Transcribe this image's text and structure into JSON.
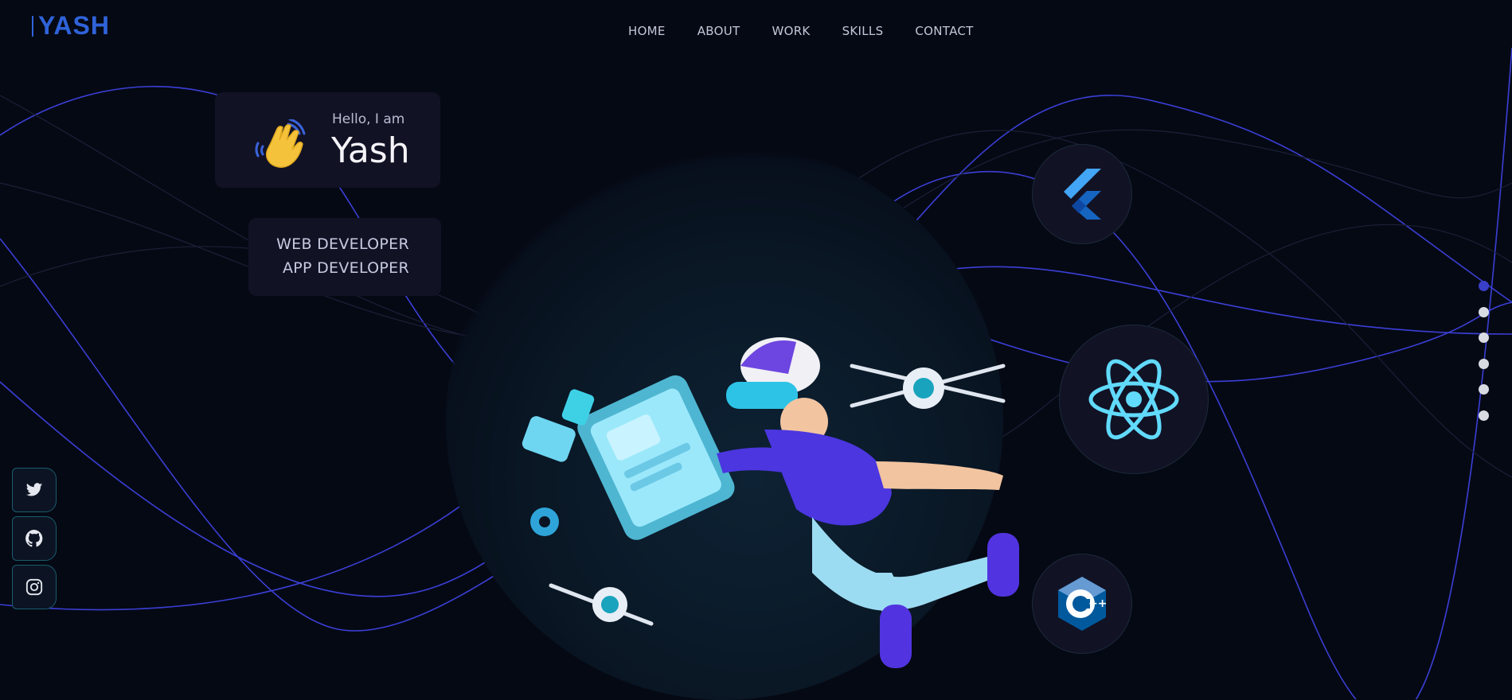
{
  "brand": {
    "logo_text": "YASH",
    "accent": "#2f63d9"
  },
  "nav": {
    "items": [
      {
        "label": "HOME"
      },
      {
        "label": "ABOUT"
      },
      {
        "label": "WORK"
      },
      {
        "label": "SKILLS"
      },
      {
        "label": "CONTACT"
      }
    ]
  },
  "intro": {
    "greeting": "Hello, I am",
    "name": "Yash",
    "emoji_icon": "waving-hand-icon"
  },
  "roles": [
    "WEB DEVELOPER",
    "APP DEVELOPER"
  ],
  "skills": [
    {
      "icon": "flutter-icon"
    },
    {
      "icon": "react-icon"
    },
    {
      "icon": "cpp-icon"
    }
  ],
  "social": [
    {
      "icon": "twitter-icon"
    },
    {
      "icon": "github-icon"
    },
    {
      "icon": "instagram-icon"
    }
  ],
  "section_dots": {
    "count": 6,
    "active_index": 0
  },
  "colors": {
    "background": "#050914",
    "card": "#121225",
    "line": "#3b3fd6",
    "active_dot": "#3a3fc9"
  }
}
